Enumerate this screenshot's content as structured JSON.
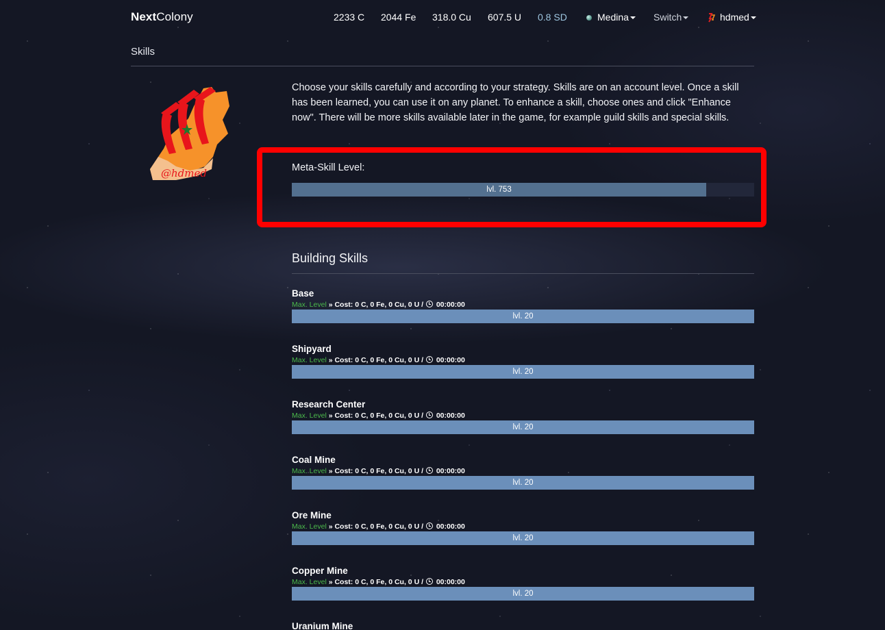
{
  "nav": {
    "brand_bold": "Next",
    "brand_rest": "Colony",
    "resources": {
      "coal": "2233 C",
      "ore": "2044 Fe",
      "copper": "318.0 Cu",
      "uranium": "607.5 U",
      "sd": "0.8 SD"
    },
    "planet": "Medina",
    "switch": "Switch",
    "user": "hdmed"
  },
  "page": {
    "title": "Skills",
    "intro": "Choose your skills carefully and according to your strategy. Skills are on an account level. Once a skill has been learned, you can use it on any planet. To enhance a skill, choose ones and click \"Enhance now\". There will be more skills available later in the game, for example guild skills and special skills."
  },
  "meta_skill": {
    "label": "Meta-Skill Level:",
    "level_text": "lvl. 753",
    "progress": 0.896
  },
  "building_skills": {
    "title": "Building Skills",
    "items": [
      {
        "name": "Base",
        "max": "Max. Level",
        "cost": " » Cost: 0 C, 0 Fe, 0 Cu, 0 U / ",
        "time": " 00:00:00",
        "level_text": "lvl. 20",
        "progress": 1.0
      },
      {
        "name": "Shipyard",
        "max": "Max. Level",
        "cost": " » Cost: 0 C, 0 Fe, 0 Cu, 0 U / ",
        "time": " 00:00:00",
        "level_text": "lvl. 20",
        "progress": 1.0
      },
      {
        "name": "Research Center",
        "max": "Max. Level",
        "cost": " » Cost: 0 C, 0 Fe, 0 Cu, 0 U / ",
        "time": " 00:00:00",
        "level_text": "lvl. 20",
        "progress": 1.0
      },
      {
        "name": "Coal Mine",
        "max": "Max. Level",
        "cost": " » Cost: 0 C, 0 Fe, 0 Cu, 0 U / ",
        "time": " 00:00:00",
        "level_text": "lvl. 20",
        "progress": 1.0
      },
      {
        "name": "Ore Mine",
        "max": "Max. Level",
        "cost": " » Cost: 0 C, 0 Fe, 0 Cu, 0 U / ",
        "time": " 00:00:00",
        "level_text": "lvl. 20",
        "progress": 1.0
      },
      {
        "name": "Copper Mine",
        "max": "Max. Level",
        "cost": " » Cost: 0 C, 0 Fe, 0 Cu, 0 U / ",
        "time": " 00:00:00",
        "level_text": "lvl. 20",
        "progress": 1.0
      },
      {
        "name": "Uranium Mine"
      }
    ]
  },
  "colors": {
    "highlight": "#ff0000",
    "meta_fill": "#53708f",
    "skill_fill": "#6b8fba",
    "max_level_green": "#4bb94b"
  }
}
